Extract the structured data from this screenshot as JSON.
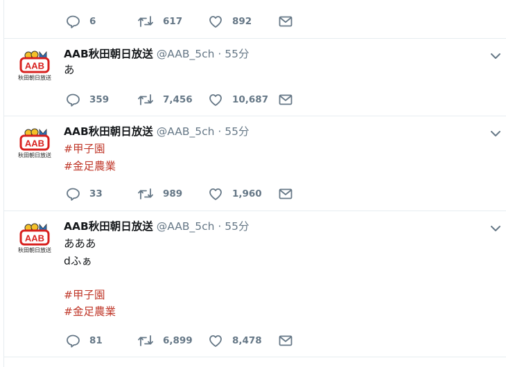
{
  "tweets": [
    {
      "partial": true,
      "counts": {
        "reply": "6",
        "retweet": "617",
        "like": "892"
      }
    },
    {
      "avatar_text": "AAB",
      "avatar_caption": "秋田朝日放送",
      "name": "AAB秋田朝日放送",
      "handle": "@AAB_5ch",
      "dot": "·",
      "time": "55分",
      "lines": [
        {
          "text": "あ",
          "type": "plain"
        }
      ],
      "counts": {
        "reply": "359",
        "retweet": "7,456",
        "like": "10,687"
      }
    },
    {
      "avatar_text": "AAB",
      "avatar_caption": "秋田朝日放送",
      "name": "AAB秋田朝日放送",
      "handle": "@AAB_5ch",
      "dot": "·",
      "time": "55分",
      "lines": [
        {
          "text": "#甲子園",
          "type": "hashtag"
        },
        {
          "text": "#金足農業",
          "type": "hashtag"
        }
      ],
      "counts": {
        "reply": "33",
        "retweet": "989",
        "like": "1,960"
      }
    },
    {
      "avatar_text": "AAB",
      "avatar_caption": "秋田朝日放送",
      "name": "AAB秋田朝日放送",
      "handle": "@AAB_5ch",
      "dot": "·",
      "time": "55分",
      "lines": [
        {
          "text": "あああ",
          "type": "plain"
        },
        {
          "text": "dふぁ",
          "type": "plain"
        },
        {
          "text": "",
          "type": "blank"
        },
        {
          "text": "#甲子園",
          "type": "hashtag"
        },
        {
          "text": "#金足農業",
          "type": "hashtag"
        }
      ],
      "counts": {
        "reply": "81",
        "retweet": "6,899",
        "like": "8,478"
      }
    }
  ],
  "icons": {
    "reply": "reply-icon",
    "retweet": "retweet-icon",
    "like": "heart-icon",
    "message": "envelope-icon",
    "more": "chevron-down-icon"
  },
  "colors": {
    "hashtag": "#c0392b",
    "muted": "#657786",
    "separator": "#e6ecf0",
    "avatar_red": "#d8201e",
    "avatar_gold": "#f3c02a"
  }
}
